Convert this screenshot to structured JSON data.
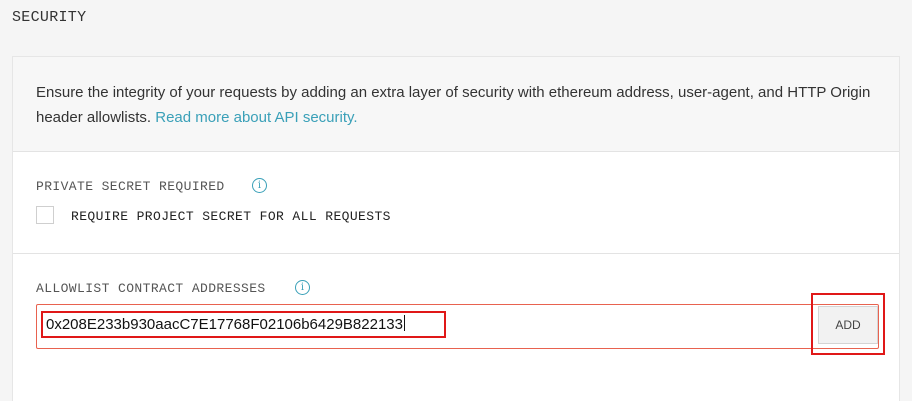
{
  "page": {
    "section_title": "SECURITY"
  },
  "intro": {
    "text": "Ensure the integrity of your requests by adding an extra layer of security with ethereum address, user-agent, and HTTP Origin header allowlists. ",
    "link_text": "Read more about API security."
  },
  "private_secret": {
    "label": "PRIVATE SECRET REQUIRED",
    "info_icon": "info-icon",
    "checkbox_checked": false,
    "checkbox_label": "REQUIRE PROJECT SECRET FOR ALL REQUESTS"
  },
  "allowlist": {
    "label": "ALLOWLIST CONTRACT ADDRESSES",
    "info_icon": "info-icon",
    "input_value": "0x208E233b930aacC7E17768F02106b6429B822133",
    "add_label": "ADD"
  },
  "colors": {
    "accent": "#3aa0b8",
    "error_border": "#e8624f",
    "highlight": "#e01818"
  }
}
